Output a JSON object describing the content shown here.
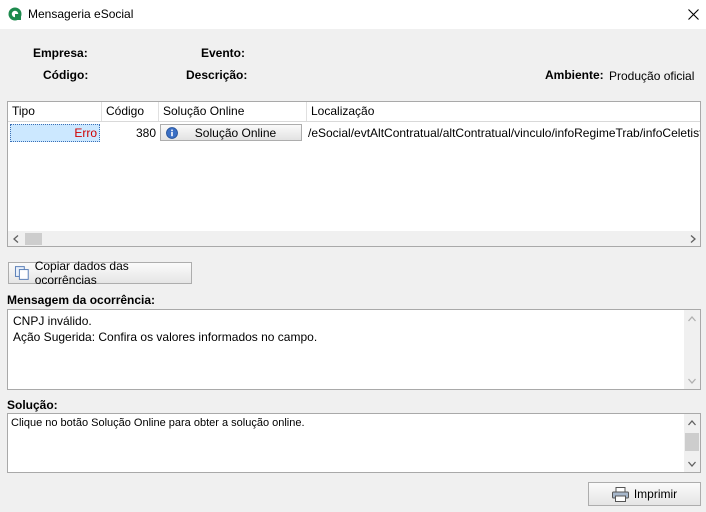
{
  "window": {
    "title": "Mensageria eSocial"
  },
  "header": {
    "empresa_label": "Empresa:",
    "codigo_label": "Código:",
    "evento_label": "Evento:",
    "descricao_label": "Descrição:",
    "ambiente_label": "Ambiente:",
    "ambiente_value": "Produção oficial"
  },
  "grid": {
    "columns": [
      "Tipo",
      "Código",
      "Solução Online",
      "Localização"
    ],
    "rows": [
      {
        "tipo": "Erro",
        "codigo": "380",
        "solucao_button": "Solução Online",
        "localizacao": "/eSocial/evtAltContratual/altContratual/vinculo/infoRegimeTrab/infoCeletista"
      }
    ]
  },
  "copy_button": {
    "label": "Copiar dados das ocorrências"
  },
  "mensagem": {
    "label": "Mensagem da ocorrência:",
    "lines": [
      "CNPJ inválido.",
      "Ação Sugerida: Confira os valores informados no campo."
    ]
  },
  "solucao": {
    "label": "Solução:",
    "text": "Clique no botão Solução Online para obter a solução online."
  },
  "print_button": {
    "label": "Imprimir"
  },
  "colors": {
    "error_text": "#d00000",
    "selection": "#cce8ff"
  }
}
